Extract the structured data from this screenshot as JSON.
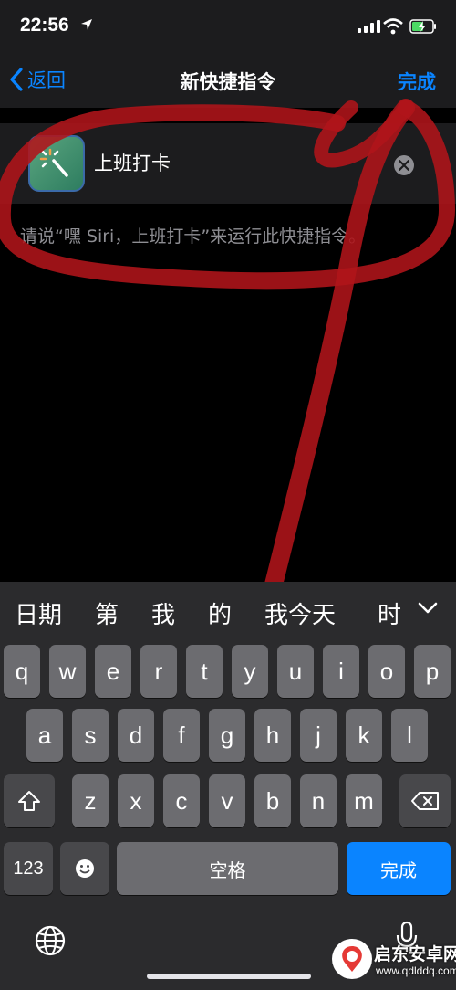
{
  "status_bar": {
    "time": "22:56"
  },
  "nav": {
    "back_label": "返回",
    "title": "新快捷指令",
    "done_label": "完成"
  },
  "shortcut": {
    "name": "上班打卡",
    "hint": "请说“嘿 Siri，上班打卡”来运行此快捷指令。"
  },
  "keyboard": {
    "candidates": [
      "日期",
      "第",
      "我",
      "的",
      "我今天",
      "时"
    ],
    "rows": [
      [
        "q",
        "w",
        "e",
        "r",
        "t",
        "y",
        "u",
        "i",
        "o",
        "p"
      ],
      [
        "a",
        "s",
        "d",
        "f",
        "g",
        "h",
        "j",
        "k",
        "l"
      ],
      [
        "z",
        "x",
        "c",
        "v",
        "b",
        "n",
        "m"
      ]
    ],
    "numbers_label": "123",
    "space_label": "空格",
    "return_label": "完成"
  },
  "watermark": {
    "title": "启东安卓网",
    "url": "www.qdlddq.com"
  },
  "colors": {
    "accent": "#0a84ff",
    "annotation": "#b0151a"
  }
}
